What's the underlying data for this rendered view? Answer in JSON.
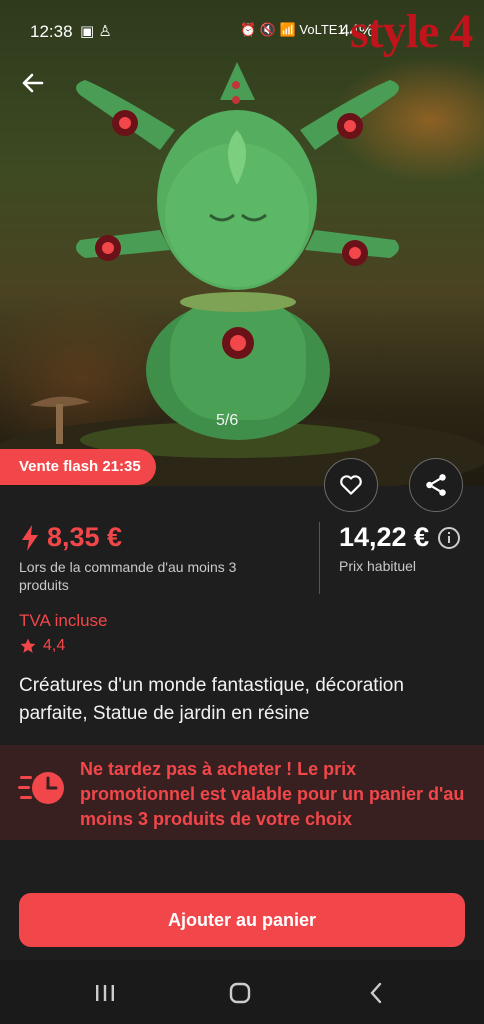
{
  "status_bar": {
    "time": "12:38",
    "battery": "44%",
    "network": "VoLTE1"
  },
  "watermark": "style 4",
  "gallery": {
    "counter": "5/6"
  },
  "flash_badge": "Vente flash 21:35",
  "price": {
    "flash_price": "8,35 €",
    "flash_condition": "Lors de la commande d'au moins 3 produits",
    "regular_price": "14,22 €",
    "regular_label": "Prix habituel"
  },
  "tva": "TVA incluse",
  "rating": "4,4",
  "product_title": "Créatures d'un monde fantastique, décoration parfaite, Statue de jardin en résine",
  "promo_banner": "Ne tardez pas à acheter ! Le prix promotionnel est valable pour un panier d'au moins 3 produits de votre choix",
  "add_to_cart": "Ajouter au panier",
  "colors": {
    "accent": "#f1474a",
    "background": "#1e1e1e",
    "promo_bg": "#392020"
  }
}
